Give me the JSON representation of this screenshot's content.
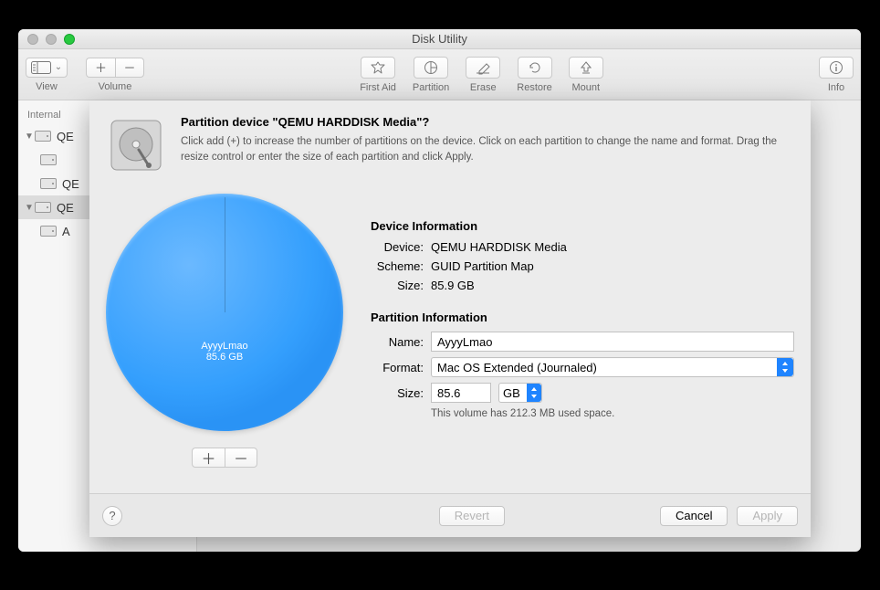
{
  "chart_data": {
    "type": "pie",
    "title": "",
    "slices": [
      {
        "label": "AyyyLmao",
        "value_gb": 85.6,
        "color": "#349ffd"
      }
    ],
    "total_gb": 85.9
  },
  "window": {
    "title": "Disk Utility"
  },
  "toolbar": {
    "view": "View",
    "volume": "Volume",
    "first_aid": "First Aid",
    "partition": "Partition",
    "erase": "Erase",
    "restore": "Restore",
    "mount": "Mount",
    "info": "Info"
  },
  "sidebar": {
    "header": "Internal",
    "items": [
      {
        "label": "QE"
      },
      {
        "label": ""
      },
      {
        "label": "QE"
      },
      {
        "label": "QE"
      },
      {
        "label": "A"
      }
    ]
  },
  "sheet": {
    "title": "Partition device \"QEMU HARDDISK Media\"?",
    "desc": "Click add (+) to increase the number of partitions on the device. Click on each partition to change the name and format. Drag the resize control or enter the size of each partition and click Apply.",
    "pie": {
      "name": "AyyyLmao",
      "size": "85.6 GB"
    },
    "device_info": {
      "title": "Device Information",
      "device_label": "Device:",
      "device_value": "QEMU HARDDISK Media",
      "scheme_label": "Scheme:",
      "scheme_value": "GUID Partition Map",
      "size_label": "Size:",
      "size_value": "85.9 GB"
    },
    "partition_info": {
      "title": "Partition Information",
      "name_label": "Name:",
      "name_value": "AyyyLmao",
      "format_label": "Format:",
      "format_value": "Mac OS Extended (Journaled)",
      "size_label": "Size:",
      "size_value": "85.6",
      "size_unit": "GB",
      "footnote": "This volume has 212.3 MB used space."
    },
    "buttons": {
      "revert": "Revert",
      "cancel": "Cancel",
      "apply": "Apply"
    }
  }
}
